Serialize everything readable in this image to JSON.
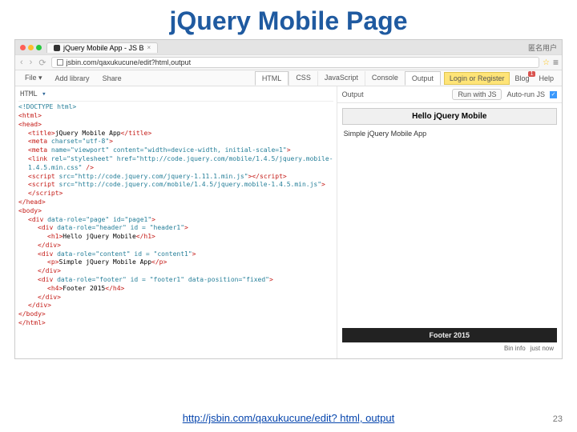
{
  "slide": {
    "title": "jQuery Mobile Page",
    "link": "http://jsbin.com/qaxukucune/edit? html, output",
    "page_number": "23"
  },
  "browser": {
    "tab_title": "jQuery Mobile App - JS B",
    "tab_close": "×",
    "chrome_right_label": "匿名用户",
    "url": "jsbin.com/qaxukucune/edit?html,output",
    "nav_back": "‹",
    "nav_fwd": "›",
    "nav_reload": "⟳",
    "star": "☆",
    "menu": "≡"
  },
  "jsbin_menu": {
    "file": "File ▾",
    "add_library": "Add library",
    "share": "Share",
    "tabs": {
      "html": "HTML",
      "css": "CSS",
      "js": "JavaScript",
      "console": "Console",
      "output": "Output"
    },
    "login": "Login or Register",
    "blog": "Blog",
    "blog_badge": "1",
    "help": "Help"
  },
  "code_panel": {
    "header_label": "HTML",
    "header_arrow": "▾",
    "lines": [
      {
        "cls": "t-doctype",
        "txt": "<!DOCTYPE html>"
      },
      {
        "cls": "t-tag",
        "txt": "<html>"
      },
      {
        "cls": "t-tag",
        "txt": "<head>"
      },
      {
        "indent": 1,
        "a": "<title>",
        "b": "jQuery Mobile App",
        "c": "</title>"
      },
      {
        "indent": 1,
        "a": "<meta ",
        "attr": "charset=\"utf-8\"",
        "c": ">"
      },
      {
        "indent": 1,
        "a": "<meta ",
        "attr": "name=\"viewport\" content=\"width=device-width, initial-scale=1\"",
        "c": ">"
      },
      {
        "indent": 1,
        "a": "<link ",
        "attr": "rel=\"stylesheet\" href=\"http://code.jquery.com/mobile/1.4.5/jquery.mobile-1.4.5.min.css\"",
        "c": " />"
      },
      {
        "indent": 1,
        "a": "<script ",
        "attr": "src=\"http://code.jquery.com/jquery-1.11.1.min.js\"",
        "c": "></script>"
      },
      {
        "indent": 1,
        "a": "<script ",
        "attr": "src=\"http://code.jquery.com/mobile/1.4.5/jquery.mobile-1.4.5.min.js\"",
        "c": "></script>"
      },
      {
        "cls": "t-tag",
        "txt": "</head>"
      },
      {
        "cls": "t-tag",
        "txt": "<body>"
      },
      {
        "indent": 1,
        "a": "<div ",
        "attr": "data-role=\"page\" id=\"page1\"",
        "c": ">"
      },
      {
        "indent": 2,
        "a": "<div ",
        "attr": "data-role=\"header\" id = \"header1\"",
        "c": ">"
      },
      {
        "indent": 3,
        "a": "<h1>",
        "b": "Hello jQuery Mobile",
        "c": "</h1>"
      },
      {
        "indent": 2,
        "cls": "t-tag",
        "txt": "</div>"
      },
      {
        "indent": 2,
        "a": "<div ",
        "attr": "data-role=\"content\" id = \"content1\"",
        "c": ">"
      },
      {
        "indent": 3,
        "a": "<p>",
        "b": "Simple jQuery Mobile App",
        "c": "</p>"
      },
      {
        "indent": 2,
        "cls": "t-tag",
        "txt": "</div>"
      },
      {
        "indent": 2,
        "a": "<div ",
        "attr": "data-role=\"footer\" id = \"footer1\" data-position=\"fixed\"",
        "c": ">"
      },
      {
        "indent": 3,
        "a": "<h4>",
        "b": "Footer 2015",
        "c": "</h4>"
      },
      {
        "indent": 2,
        "cls": "t-tag",
        "txt": "</div>"
      },
      {
        "indent": 1,
        "cls": "t-tag",
        "txt": "</div>"
      },
      {
        "cls": "t-tag",
        "txt": "</body>"
      },
      {
        "cls": "t-tag",
        "txt": "</html>"
      }
    ]
  },
  "output_panel": {
    "label": "Output",
    "run": "Run with JS",
    "auto": "Auto-run JS",
    "check": "✓",
    "preview_header": "Hello jQuery Mobile",
    "preview_body": "Simple jQuery Mobile App",
    "preview_footer": "Footer 2015",
    "bin_info": "Bin info",
    "just_now": "just now"
  }
}
